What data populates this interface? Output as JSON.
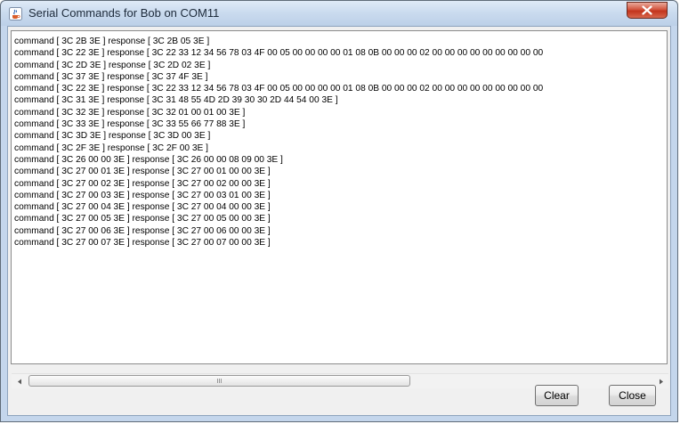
{
  "window": {
    "title": "Serial Commands for Bob on COM11"
  },
  "log": {
    "lines": [
      "command [ 3C 2B 3E ] response [ 3C 2B 05 3E ]",
      "command [ 3C 22 3E ] response [ 3C 22 33 12 34 56 78 03 4F 00 05 00 00 00 00 01 08 0B 00 00 00 02 00 00 00 00 00 00 00 00 00",
      "command [ 3C 2D 3E ] response [ 3C 2D 02 3E ]",
      "command [ 3C 37 3E ] response [ 3C 37 4F 3E ]",
      "command [ 3C 22 3E ] response [ 3C 22 33 12 34 56 78 03 4F 00 05 00 00 00 00 01 08 0B 00 00 00 02 00 00 00 00 00 00 00 00 00",
      "command [ 3C 31 3E ] response [ 3C 31 48 55 4D 2D 39 30 30 2D 44 54 00 3E ]",
      "command [ 3C 32 3E ] response [ 3C 32 01 00 01 00 3E ]",
      "command [ 3C 33 3E ] response [ 3C 33 55 66 77 88 3E ]",
      "command [ 3C 3D 3E ] response [ 3C 3D 00 3E ]",
      "command [ 3C 2F 3E ] response [ 3C 2F 00 3E ]",
      "command [ 3C 26 00 00 3E ] response [ 3C 26 00 00 08 09 00 3E ]",
      "command [ 3C 27 00 01 3E ] response [ 3C 27 00 01 00 00 3E ]",
      "command [ 3C 27 00 02 3E ] response [ 3C 27 00 02 00 00 3E ]",
      "command [ 3C 27 00 03 3E ] response [ 3C 27 00 03 01 00 3E ]",
      "command [ 3C 27 00 04 3E ] response [ 3C 27 00 04 00 00 3E ]",
      "command [ 3C 27 00 05 3E ] response [ 3C 27 00 05 00 00 3E ]",
      "command [ 3C 27 00 06 3E ] response [ 3C 27 00 06 00 00 3E ]",
      "command [ 3C 27 00 07 3E ] response [ 3C 27 00 07 00 00 3E ]"
    ]
  },
  "scrollbar": {
    "grip_glyph": "III"
  },
  "buttons": {
    "clear_label": "Clear",
    "close_label": "Close"
  },
  "icons": {
    "app": "java-cup-icon",
    "close": "close-icon",
    "left_arrow": "arrow-left-icon",
    "right_arrow": "arrow-right-icon"
  },
  "colors": {
    "titlebar": "#c9daee",
    "close_button": "#c7432b",
    "client_bg": "#f0f0f0"
  }
}
